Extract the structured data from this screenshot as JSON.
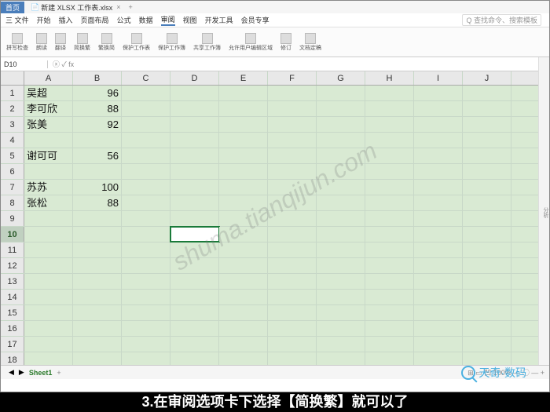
{
  "titlebar": {
    "app_label": "首页",
    "doc_icon": "📄",
    "doc_name": "新建 XLSX 工作表.xlsx",
    "close": "×",
    "plus": "+"
  },
  "menubar": {
    "items": [
      "三 文件",
      "开始",
      "插入",
      "页面布局",
      "公式",
      "数据",
      "审阅",
      "视图",
      "开发工具",
      "会员专享"
    ],
    "active_index": 6,
    "search_placeholder": "Q 查找命令、搜索模板"
  },
  "ribbon": {
    "btns": [
      "拼写检查",
      "朗读",
      "翻译",
      "简换繁",
      "繁换简",
      "保护工作表",
      "保护工作簿",
      "共享工作簿",
      "允许用户编辑区域",
      "修订",
      "文档定稿"
    ]
  },
  "namebox": {
    "ref": "D10",
    "fx": "ⓧ  ✓  fx"
  },
  "columns": [
    "A",
    "B",
    "C",
    "D",
    "E",
    "F",
    "G",
    "H",
    "I",
    "J"
  ],
  "rows_count": 18,
  "selected_cell": {
    "row": 10,
    "col": 4
  },
  "data": {
    "1": {
      "A": "吴超",
      "B": "96"
    },
    "2": {
      "A": "李可欣",
      "B": "88"
    },
    "3": {
      "A": "张美",
      "B": "92"
    },
    "5": {
      "A": "谢可可",
      "B": "56"
    },
    "7": {
      "A": "苏苏",
      "B": "100"
    },
    "8": {
      "A": "张松",
      "B": "88"
    }
  },
  "sheets": {
    "active": "Sheet1",
    "add": "+"
  },
  "statusbar_right": "⊞ ▭ 凹 100% — ◯ — +",
  "caption": "3.在审阅选项卡下选择【简换繁】就可以了",
  "watermark": "shuma.tianqijun.com",
  "logo_text": "天奇·数码",
  "sidebar_label": "分析"
}
